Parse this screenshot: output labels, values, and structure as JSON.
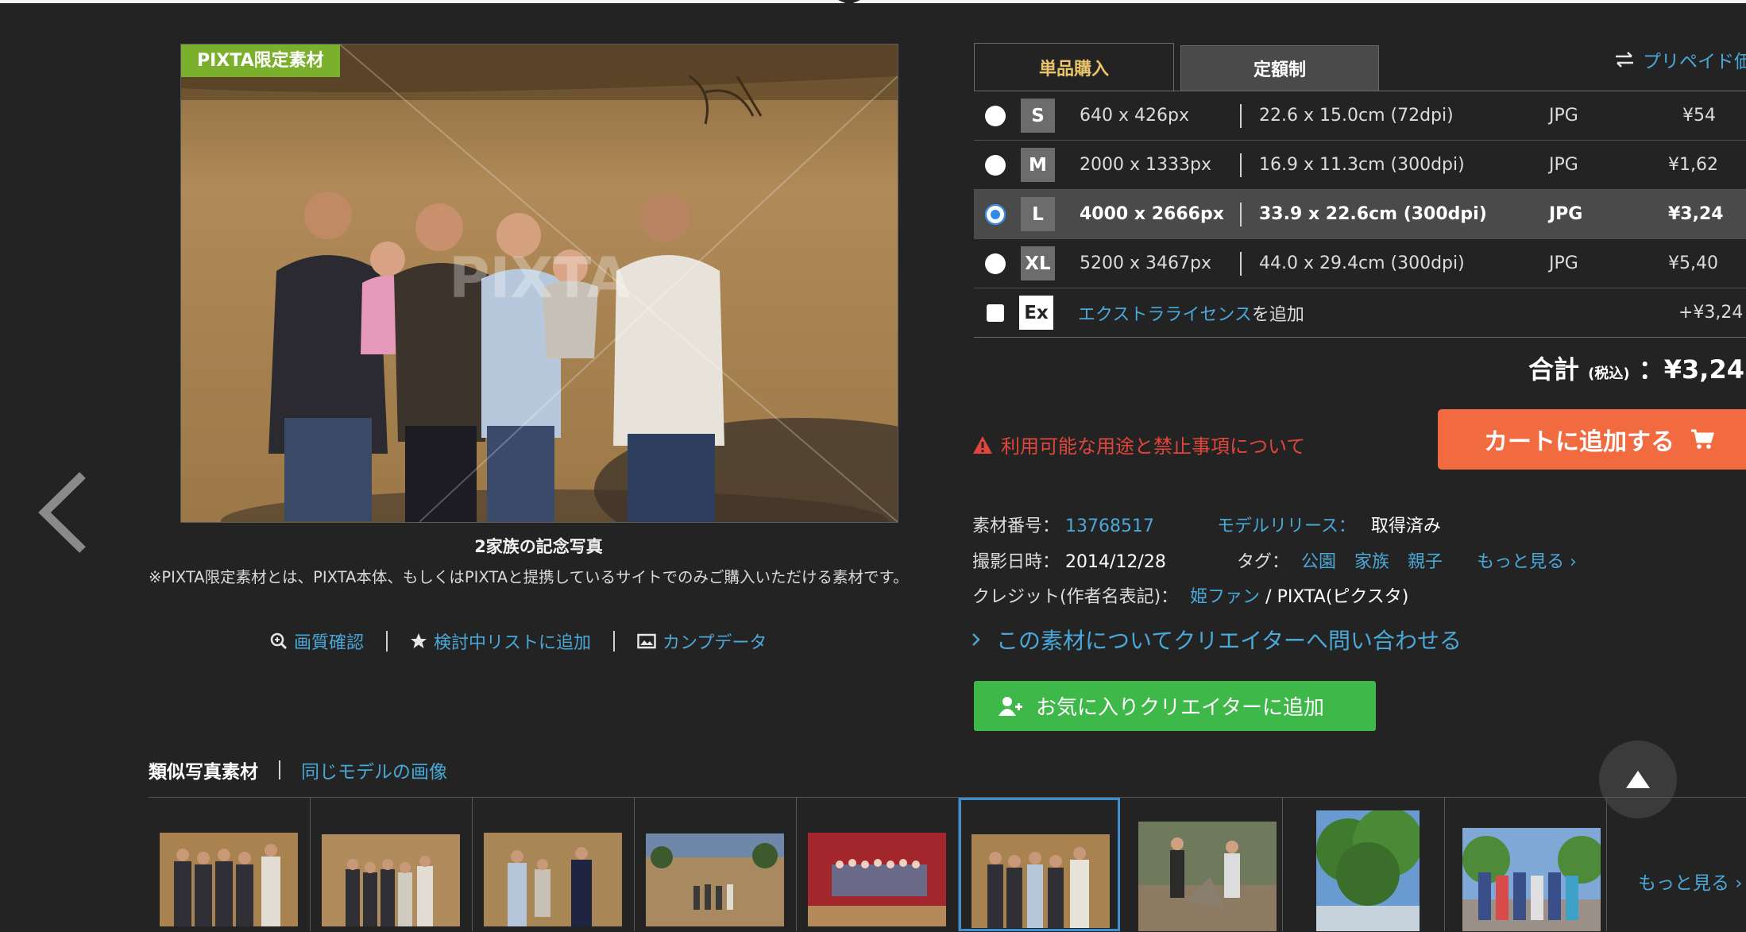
{
  "badge": "PIXTA限定素材",
  "image": {
    "watermark": "PIXTA",
    "caption": "2家族の記念写真",
    "note": "※PIXTA限定素材とは、PIXTA本体、もしくはPIXTAと提携しているサイトでのみご購入いただける素材です。"
  },
  "actions": [
    {
      "label": "画質確認",
      "icon": "zoom-icon"
    },
    {
      "label": "検討中リストに追加",
      "icon": "star-icon"
    },
    {
      "label": "カンプデータ",
      "icon": "image-icon"
    }
  ],
  "tabs": {
    "active": "単品購入",
    "inactive": "定額制"
  },
  "prepaid_link": "プリペイド価",
  "sizes": [
    {
      "letter": "S",
      "px": "640 x 426px",
      "cm": "22.6 x 15.0cm (72dpi)",
      "format": "JPG",
      "price": "¥54",
      "selected": false
    },
    {
      "letter": "M",
      "px": "2000 x 1333px",
      "cm": "16.9 x 11.3cm (300dpi)",
      "format": "JPG",
      "price": "¥1,62",
      "selected": false
    },
    {
      "letter": "L",
      "px": "4000 x 2666px",
      "cm": "33.9 x 22.6cm (300dpi)",
      "format": "JPG",
      "price": "¥3,24",
      "selected": true
    },
    {
      "letter": "XL",
      "px": "5200 x 3467px",
      "cm": "44.0 x 29.4cm (300dpi)",
      "format": "JPG",
      "price": "¥5,40",
      "selected": false
    }
  ],
  "extra_license": {
    "letter": "Ex",
    "link": "エクストラライセンス",
    "suffix": "を追加",
    "price": "+¥3,24"
  },
  "total": {
    "label": "合計",
    "tax": "(税込)",
    "sep": "：",
    "value": "¥3,24"
  },
  "warning": "利用可能な用途と禁止事項について",
  "cart_button": "カートに追加する",
  "meta": {
    "id_label": "素材番号：",
    "id_value": "13768517",
    "release_label": "モデルリリース：",
    "release_value": "取得済み",
    "date_label": "撮影日時：",
    "date_value": "2014/12/28",
    "tag_label": "タグ：",
    "tags": [
      "公園",
      "家族",
      "親子"
    ],
    "more_tags": "もっと見る ›",
    "credit_label": "クレジット(作者名表記)：",
    "credit_author": "姫ファン",
    "credit_sep": " / ",
    "credit_site": "PIXTA(ピクスタ)"
  },
  "inquiry": "この素材についてクリエイターへ問い合わせる",
  "fav_button": "お気に入りクリエイターに追加",
  "similar": {
    "active": "類似写真素材",
    "other": "同じモデルの画像"
  },
  "more": "もっと見る ›",
  "colors": {
    "accent_blue": "#4aa8d8",
    "cart_orange": "#f26a3f",
    "fav_green": "#3fb84a",
    "badge_green": "#7ab02c",
    "warn_red": "#e0463b"
  }
}
